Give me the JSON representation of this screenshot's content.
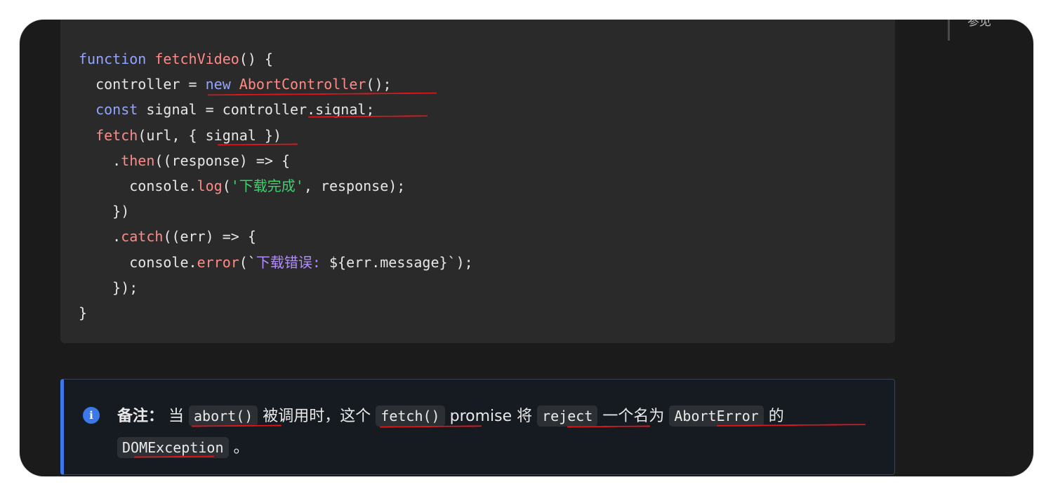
{
  "sidebar": {
    "label": "参见"
  },
  "code": {
    "l1": {
      "a": "function",
      "b": "fetchVideo",
      "c": "() {"
    },
    "l2": {
      "a": "  controller = ",
      "b": "new",
      "c": " ",
      "d": "AbortController",
      "e": "();"
    },
    "l3": {
      "a": "  ",
      "b": "const",
      "c": " signal = controller",
      "d": ".signal;"
    },
    "l4": {
      "a": "  ",
      "b": "fetch",
      "c": "(url, { signal })"
    },
    "l5": {
      "a": "    .",
      "b": "then",
      "c": "((response) => {"
    },
    "l6": {
      "a": "      console.",
      "b": "log",
      "c": "(",
      "d": "'下载完成'",
      "e": ", response);"
    },
    "l7": {
      "a": "    })"
    },
    "l8": {
      "a": "    .",
      "b": "catch",
      "c": "((err) => {"
    },
    "l9": {
      "a": "      console.",
      "b": "error",
      "c": "(`",
      "d": "下载错误: ",
      "e": "${err.message}`);"
    },
    "l10": {
      "a": "    });"
    },
    "l11": {
      "a": "}"
    }
  },
  "note": {
    "icon": "info-icon",
    "label": "备注：",
    "t1": " 当 ",
    "c1": "abort()",
    "t2": " 被调用时，这个 ",
    "c2": "fetch()",
    "t3": " promise 将 ",
    "c3": "reject",
    "t4": " 一个名为 ",
    "c4": "AbortError",
    "t5": " 的 ",
    "c5": "DOMException",
    "t6": " 。"
  },
  "colors": {
    "accent": "#3c78e8",
    "annotation": "#e0161b",
    "keyword": "#93a5ff",
    "function": "#ff8a87",
    "string": "#3fcf6f"
  }
}
